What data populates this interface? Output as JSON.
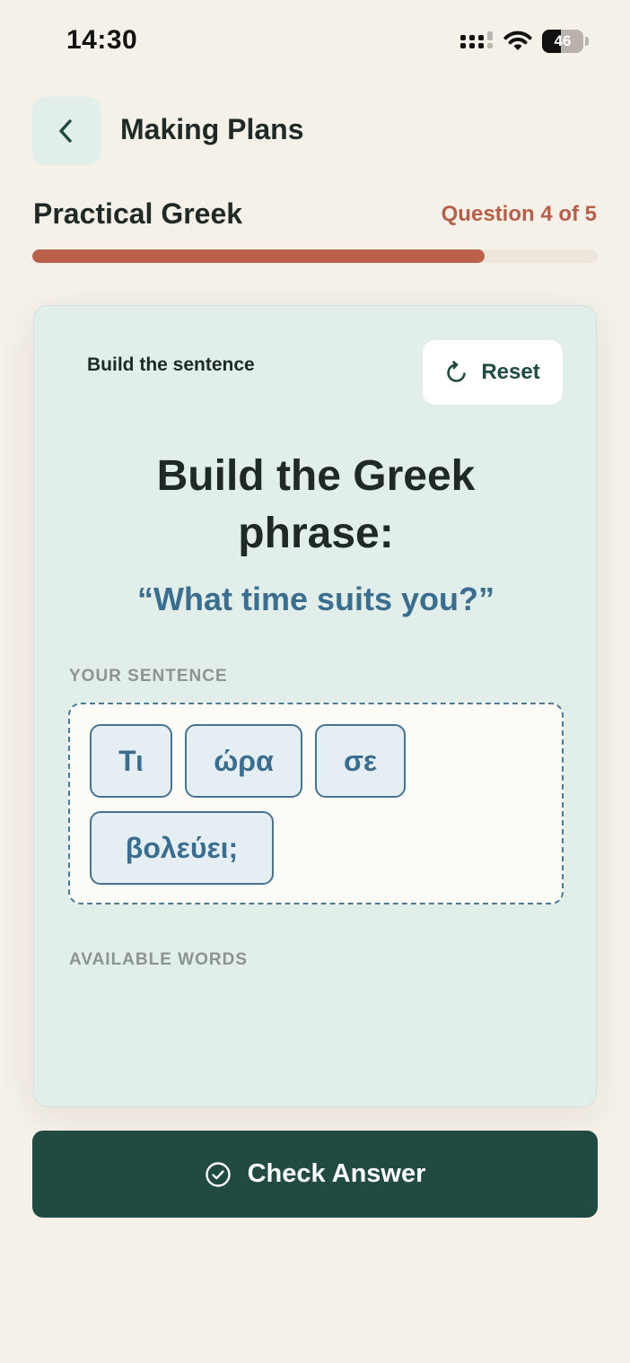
{
  "status_bar": {
    "time": "14:30",
    "battery_percent": "46",
    "battery_level": 0.46,
    "icons": [
      "cellular-signal-icon",
      "wifi-icon",
      "battery-icon"
    ]
  },
  "header": {
    "back_icon": "chevron-left-icon",
    "title": "Making Plans"
  },
  "course": {
    "title": "Practical Greek",
    "question_counter": "Question 4 of 5",
    "progress_fraction": 0.8
  },
  "exercise": {
    "label": "Build the sentence",
    "reset_label": "Reset",
    "reset_icon": "refresh-icon",
    "prompt_line1": "Build the Greek",
    "prompt_line2": "phrase:",
    "target_phrase": "“What time suits you?”",
    "your_sentence_label": "YOUR SENTENCE",
    "selected_words": [
      "Τι",
      "ώρα",
      "σε",
      "βολεύει;"
    ],
    "available_words_label": "AVAILABLE WORDS",
    "available_words": []
  },
  "check_button": {
    "label": "Check Answer",
    "icon": "check-circle-icon"
  },
  "colors": {
    "background": "#f5f0e8",
    "accent": "#b9614b",
    "card": "#e2eeea",
    "primary_dark": "#214a43",
    "word_blue": "#3b6e8e"
  }
}
